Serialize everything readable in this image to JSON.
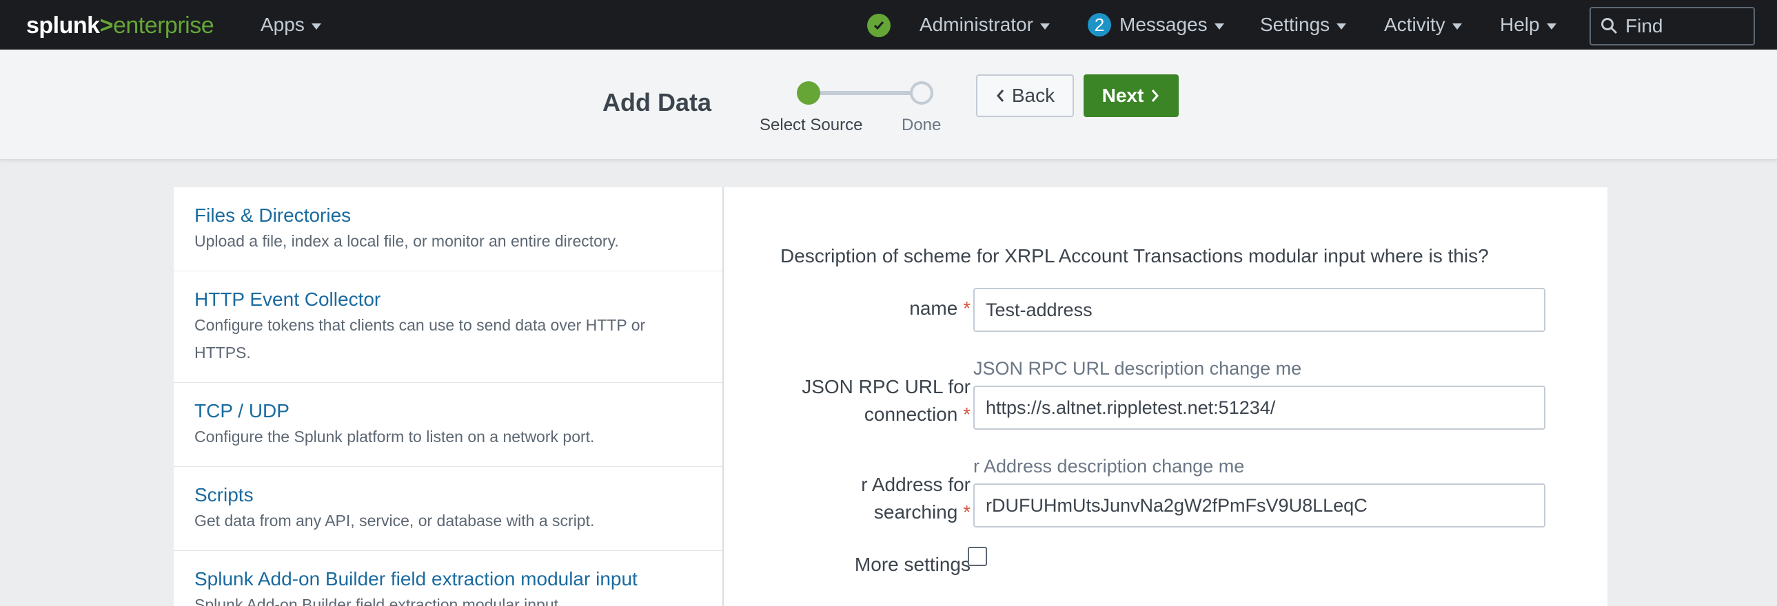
{
  "header": {
    "logo_brand": "splunk",
    "logo_gt": ">",
    "logo_product": "enterprise",
    "apps_label": "Apps",
    "status_icon": "check-icon",
    "user_label": "Administrator",
    "messages_count": "2",
    "messages_label": "Messages",
    "settings_label": "Settings",
    "activity_label": "Activity",
    "help_label": "Help",
    "find_placeholder": "Find"
  },
  "wizard": {
    "title": "Add Data",
    "steps": [
      {
        "label": "Select Source",
        "state": "active"
      },
      {
        "label": "Done",
        "state": "pending"
      }
    ],
    "back_label": "Back",
    "next_label": "Next"
  },
  "sources": [
    {
      "title": "Files & Directories",
      "desc": "Upload a file, index a local file, or monitor an entire directory."
    },
    {
      "title": "HTTP Event Collector",
      "desc": "Configure tokens that clients can use to send data over HTTP or",
      "desc2": "HTTPS."
    },
    {
      "title": "TCP / UDP",
      "desc": "Configure the Splunk platform to listen on a network port."
    },
    {
      "title": "Scripts",
      "desc": "Get data from any API, service, or database with a script."
    },
    {
      "title": "Splunk Add-on Builder field extraction modular input",
      "desc": "Splunk Add-on Builder field extraction modular input"
    }
  ],
  "form": {
    "description": "Description of scheme for XRPL Account Transactions modular input where is this?",
    "fields": {
      "name": {
        "label": "name",
        "value": "Test-address"
      },
      "rpc": {
        "label1": "JSON RPC URL for",
        "label2": "connection",
        "help": "JSON RPC URL description change me",
        "value": "https://s.altnet.rippletest.net:51234/"
      },
      "address": {
        "label1": "r Address for",
        "label2": "searching",
        "help": "r Address description change me",
        "value": "rDUFUHmUtsJunvNa2gW2fPmFsV9U8LLeqC"
      }
    },
    "required_mark": "*",
    "more_settings_label": "More settings"
  },
  "colors": {
    "accent_green": "#65a637",
    "next_button": "#3c8527",
    "link_blue": "#1a6ba0",
    "required_red": "#d6563c",
    "topbar_bg": "#1a1c20"
  }
}
